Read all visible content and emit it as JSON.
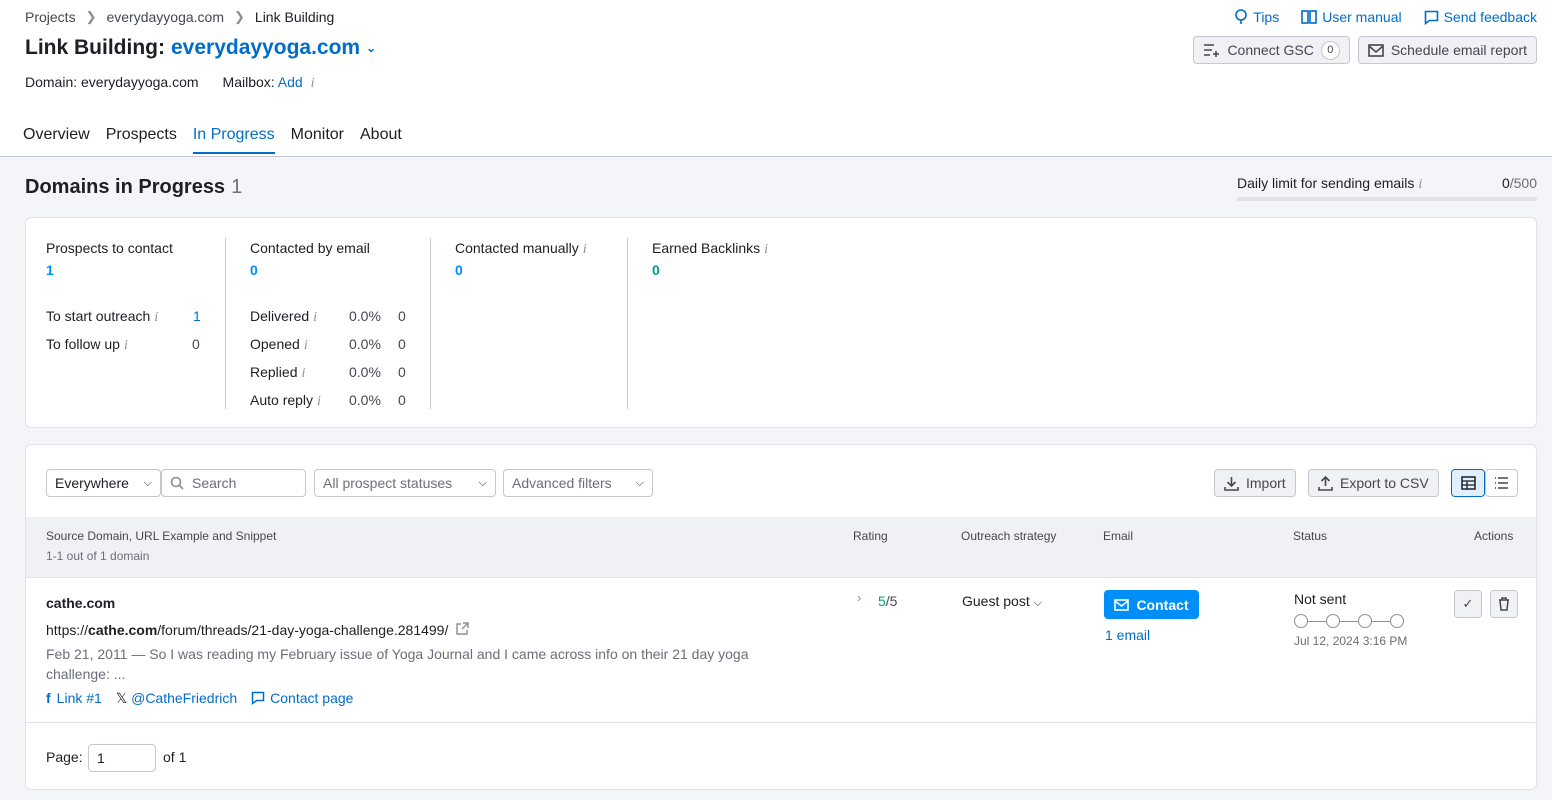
{
  "breadcrumbs": [
    "Projects",
    "everydayyoga.com",
    "Link Building"
  ],
  "top_links": {
    "tips": "Tips",
    "manual": "User manual",
    "feedback": "Send feedback"
  },
  "header": {
    "title_prefix": "Link Building:",
    "domain": "everydayyoga.com"
  },
  "top_buttons": {
    "gsc": "Connect GSC",
    "gsc_count": "0",
    "schedule": "Schedule email report"
  },
  "meta": {
    "domain_label": "Domain: everydayyoga.com",
    "mailbox_label": "Mailbox:",
    "mailbox_action": "Add"
  },
  "tabs": [
    "Overview",
    "Prospects",
    "In Progress",
    "Monitor",
    "About"
  ],
  "section": {
    "title": "Domains in Progress",
    "count": "1",
    "limit_label": "Daily limit for sending emails",
    "limit_used": "0",
    "limit_total": "/500",
    "limit_fraction": 0
  },
  "stats": {
    "prospects": {
      "label": "Prospects to contact",
      "value": "1",
      "rows": [
        {
          "label": "To start outreach",
          "value": "1"
        },
        {
          "label": "To follow up",
          "value": "0"
        }
      ]
    },
    "email": {
      "label": "Contacted by email",
      "value": "0",
      "rows": [
        {
          "label": "Delivered",
          "pct": "0.0%",
          "value": "0"
        },
        {
          "label": "Opened",
          "pct": "0.0%",
          "value": "0"
        },
        {
          "label": "Replied",
          "pct": "0.0%",
          "value": "0"
        },
        {
          "label": "Auto reply",
          "pct": "0.0%",
          "value": "0"
        }
      ]
    },
    "manual": {
      "label": "Contacted manually",
      "value": "0"
    },
    "earned": {
      "label": "Earned Backlinks",
      "value": "0"
    }
  },
  "filters": {
    "scope": "Everywhere",
    "search_placeholder": "Search",
    "status": "All prospect statuses",
    "advanced": "Advanced filters",
    "import": "Import",
    "export": "Export to CSV"
  },
  "table": {
    "headers": {
      "source": "Source Domain, URL Example and Snippet",
      "count": "1-1 out of 1 domain",
      "rating": "Rating",
      "strategy": "Outreach strategy",
      "email": "Email",
      "status": "Status",
      "actions": "Actions"
    },
    "rows": [
      {
        "domain": "cathe.com",
        "url_prefix": "https://",
        "url_domain": "cathe.com",
        "url_path": "/forum/threads/21-day-yoga-challenge.281499/",
        "snippet_line1": "Feb 21, 2011 — So I was reading my February issue of Yoga Journal and I came across info on their 21 day yoga",
        "snippet_line2": "challenge: ...",
        "links": [
          {
            "icon": "facebook-icon",
            "label": "Link #1"
          },
          {
            "icon": "x-icon",
            "label": "@CatheFriedrich"
          },
          {
            "icon": "chat-icon",
            "label": "Contact page"
          }
        ],
        "rating": "5",
        "rating_max": "/5",
        "strategy": "Guest post",
        "contact": "Contact",
        "emails": "1 email",
        "status": "Not sent",
        "date": "Jul 12, 2024 3:16 PM"
      }
    ]
  },
  "pagination": {
    "label": "Page:",
    "value": "1",
    "of": "of 1"
  }
}
